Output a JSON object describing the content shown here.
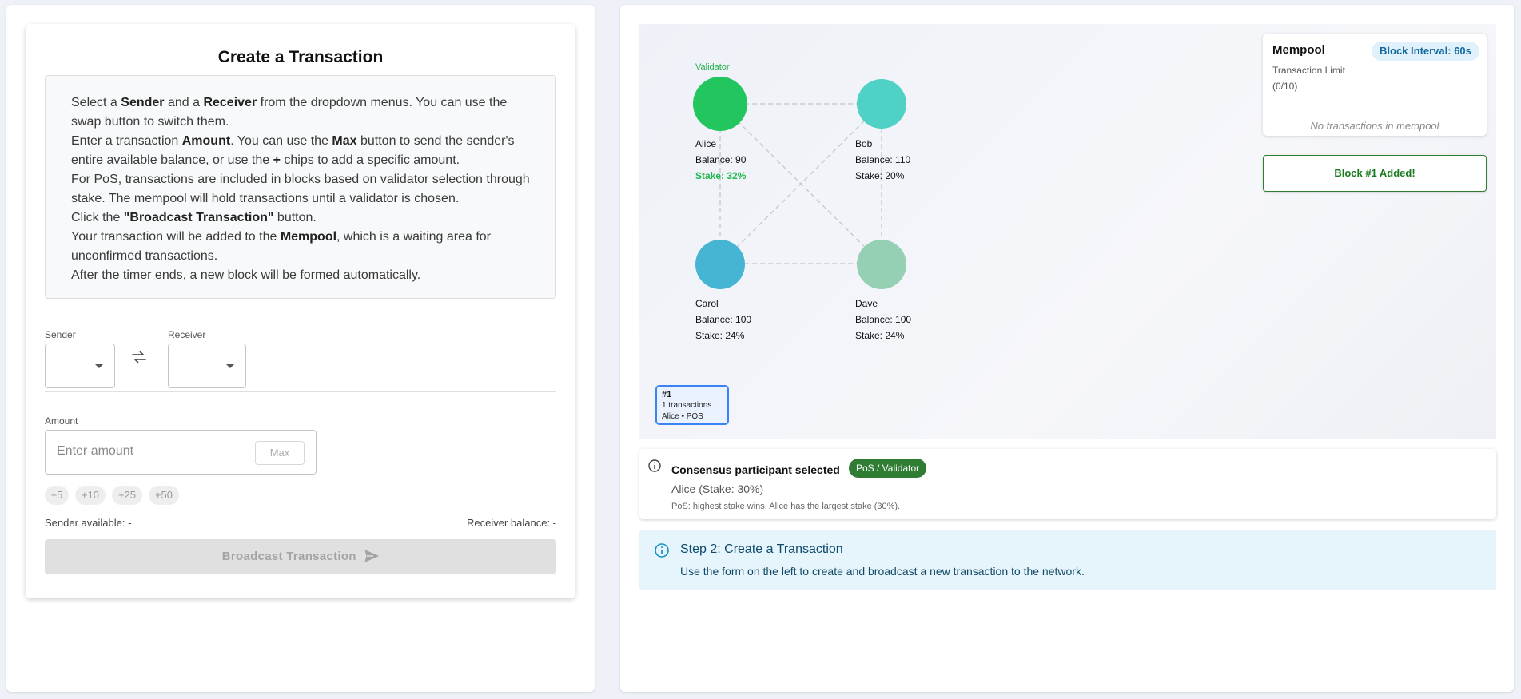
{
  "form": {
    "title": "Create a Transaction",
    "instructions": [
      [
        {
          "t": "Select a "
        },
        {
          "t": "Sender",
          "b": true
        },
        {
          "t": " and a "
        },
        {
          "t": "Receiver",
          "b": true
        },
        {
          "t": " from the dropdown menus. You can use the swap button to switch them."
        }
      ],
      [
        {
          "t": "Enter a transaction "
        },
        {
          "t": "Amount",
          "b": true
        },
        {
          "t": ". You can use the "
        },
        {
          "t": "Max",
          "b": true
        },
        {
          "t": " button to send the sender's entire available balance, or use the "
        },
        {
          "t": "+",
          "b": true
        },
        {
          "t": " chips to add a specific amount."
        }
      ],
      [
        {
          "t": "For PoS, transactions are included in blocks based on validator selection through stake. The mempool will hold transactions until a validator is chosen."
        }
      ],
      [
        {
          "t": "Click the "
        },
        {
          "t": "\"Broadcast Transaction\"",
          "b": true
        },
        {
          "t": " button."
        }
      ],
      [
        {
          "t": "Your transaction will be added to the "
        },
        {
          "t": "Mempool",
          "b": true
        },
        {
          "t": ", which is a waiting area for unconfirmed transactions."
        }
      ],
      [
        {
          "t": "After the timer ends, a new block will be formed automatically."
        }
      ]
    ],
    "sender_label": "Sender",
    "receiver_label": "Receiver",
    "amount_label": "Amount",
    "amount_placeholder": "Enter amount",
    "max_label": "Max",
    "chips": [
      "+5",
      "+10",
      "+25",
      "+50"
    ],
    "sender_available": "Sender available: -",
    "receiver_balance": "Receiver balance: -",
    "broadcast_label": "Broadcast Transaction"
  },
  "network": {
    "validator_label": "Validator",
    "nodes": [
      {
        "name": "Alice",
        "balance": "Balance: 90",
        "stake": "Stake: 32%",
        "color": "#22c55e",
        "validator": true
      },
      {
        "name": "Bob",
        "balance": "Balance: 110",
        "stake": "Stake: 20%",
        "color": "#4fd1c5",
        "validator": false
      },
      {
        "name": "Carol",
        "balance": "Balance: 100",
        "stake": "Stake: 24%",
        "color": "#45b5d3",
        "validator": false
      },
      {
        "name": "Dave",
        "balance": "Balance: 100",
        "stake": "Stake: 24%",
        "color": "#96d0b4",
        "validator": false
      }
    ],
    "edge_color": "#c9cdd3"
  },
  "mempool": {
    "title": "Mempool",
    "interval": "Block Interval: 60s",
    "limit_label": "Transaction Limit",
    "limit_count": "(0/10)",
    "empty": "No transactions in mempool"
  },
  "block_added": "Block #1 Added!",
  "chain": [
    {
      "number": "#1",
      "txs": "1 transactions",
      "meta": "Alice • POS"
    }
  ],
  "consensus": {
    "title": "Consensus participant selected",
    "badge": "PoS / Validator",
    "selected": "Alice (Stake: 30%)",
    "note": "PoS: highest stake wins. Alice has the largest stake (30%)."
  },
  "step": {
    "title": "Step 2: Create a Transaction",
    "body": "Use the form on the left to create and broadcast a new transaction to the network."
  }
}
